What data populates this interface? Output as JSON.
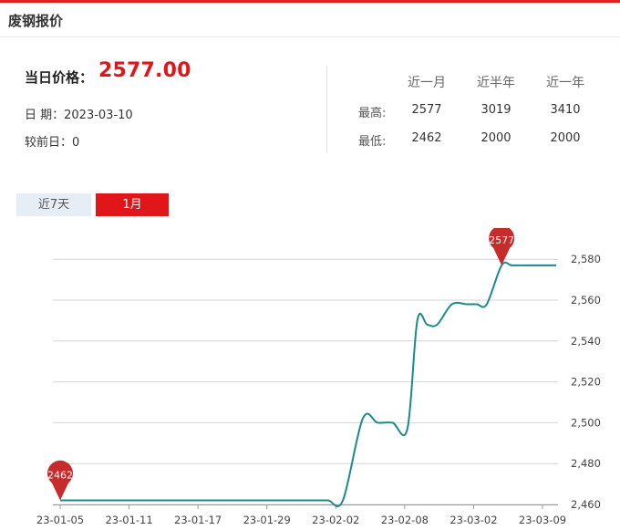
{
  "header": {
    "title": "废钢报价"
  },
  "summary": {
    "today_label": "当日价格：",
    "today_value": "2577.00",
    "date_text": "日 期：2023-03-10",
    "change_text": "较前日：0"
  },
  "stats": {
    "headers": [
      "近一月",
      "近半年",
      "近一年"
    ],
    "rows": [
      {
        "label": "最高:",
        "values": [
          "2577",
          "3019",
          "3410"
        ]
      },
      {
        "label": "最低:",
        "values": [
          "2462",
          "2000",
          "2000"
        ]
      }
    ]
  },
  "tabs": [
    {
      "label": "近7天",
      "active": false
    },
    {
      "label": "1月",
      "active": true
    }
  ],
  "colors": {
    "accent": "#e0161b",
    "line": "#1a8a8a",
    "pin": "#c62c2c"
  },
  "chart_data": {
    "type": "line",
    "x_ticks": [
      "23-01-05",
      "23-01-11",
      "23-01-17",
      "23-01-29",
      "23-02-02",
      "23-02-08",
      "23-03-02",
      "23-03-09"
    ],
    "y_ticks": [
      2460,
      2480,
      2500,
      2520,
      2540,
      2560,
      2580
    ],
    "y_tick_labels": [
      "2,460",
      "2,480",
      "2,500",
      "2,520",
      "2,540",
      "2,560",
      "2,580"
    ],
    "ylim": [
      2460,
      2585
    ],
    "y_axis_position": "right",
    "grid": true,
    "series": [
      {
        "x": [
          "23-01-05",
          "23-01-06",
          "23-01-09",
          "23-01-10",
          "23-01-11",
          "23-01-12",
          "23-01-13",
          "23-01-16",
          "23-01-17",
          "23-01-18",
          "23-01-19",
          "23-01-20",
          "23-01-29",
          "23-01-30",
          "23-01-31",
          "23-02-01",
          "23-02-02",
          "23-02-03",
          "23-02-06",
          "23-02-07",
          "23-02-08",
          "23-02-09",
          "23-02-10",
          "23-02-13",
          "23-02-14",
          "23-02-15",
          "23-02-16",
          "23-02-17",
          "23-02-20",
          "23-03-01",
          "23-03-02",
          "23-03-03",
          "23-03-06",
          "23-03-07",
          "23-03-08",
          "23-03-09",
          "23-03-10"
        ],
        "values": [
          2462,
          2462,
          2462,
          2462,
          2462,
          2462,
          2462,
          2462,
          2462,
          2462,
          2462,
          2462,
          2462,
          2462,
          2462,
          2462,
          2462,
          2502,
          2500,
          2500,
          2497,
          2550,
          2548,
          2548,
          2558,
          2558,
          2558,
          2558,
          2577,
          2577,
          2577,
          2577,
          2577,
          2577,
          2577,
          2577,
          2577
        ]
      }
    ],
    "markers": [
      {
        "label": "2462",
        "value": 2462,
        "at": "min"
      },
      {
        "label": "2577",
        "value": 2577,
        "at": "max"
      }
    ]
  }
}
